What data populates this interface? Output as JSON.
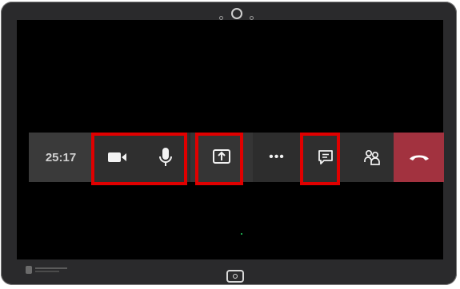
{
  "meeting": {
    "timer": "25:17"
  },
  "toolbar": {
    "camera": {
      "icon": "video-camera-icon"
    },
    "mic": {
      "icon": "microphone-icon"
    },
    "share": {
      "icon": "share-screen-icon"
    },
    "more": {
      "label": "•••",
      "icon": "more-options-icon"
    },
    "chat": {
      "icon": "chat-icon"
    },
    "people": {
      "icon": "participants-icon"
    },
    "hangup": {
      "icon": "hang-up-icon"
    }
  },
  "colors": {
    "toolbar_bg": "#2b2b2b",
    "hangup": "#a2323f",
    "highlight": "#e00000",
    "screen": "#000000",
    "frame": "#2a2a2c"
  }
}
